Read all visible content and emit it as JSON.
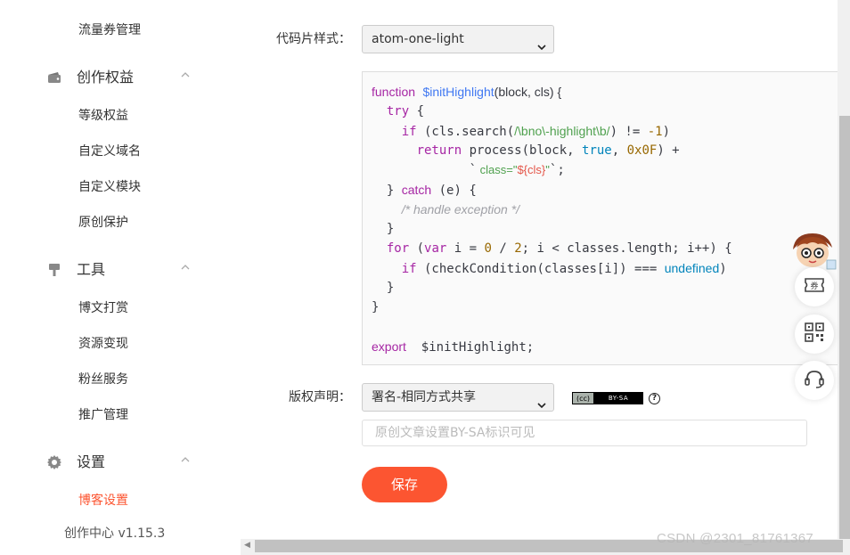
{
  "sidebar": {
    "top_item": "流量券管理",
    "groups": [
      {
        "label": "创作权益",
        "icon": "wallet-icon",
        "items": [
          "等级权益",
          "自定义域名",
          "自定义模块",
          "原创保护"
        ]
      },
      {
        "label": "工具",
        "icon": "hammer-icon",
        "items": [
          "博文打赏",
          "资源变现",
          "粉丝服务",
          "推广管理"
        ]
      },
      {
        "label": "设置",
        "icon": "gear-icon",
        "items": [
          "博客设置"
        ]
      }
    ],
    "active_item": "博客设置",
    "version": "创作中心 v1.15.3"
  },
  "form": {
    "code_style_label": "代码片样式：",
    "code_style_value": "atom-one-light",
    "copyright_label": "版权声明：",
    "copyright_value": "署名-相同方式共享",
    "cc_badge_left": "(cc)",
    "cc_badge_right": "BY-SA",
    "help_icon": "?",
    "hint_placeholder": "原创文章设置BY-SA标识可见",
    "save_label": "保存"
  },
  "code_sample": {
    "l1_kw": "function",
    "l1_fn": "$initHighlight",
    "l1_rest": "(block, cls) {",
    "l2_kw": "try",
    "l2_rest": " {",
    "l3_kw": "if",
    "l3_a": " (cls.search(",
    "l3_re": "/\\bno\\-highlight\\b/",
    "l3_b": ") != ",
    "l3_num": "-1",
    "l3_c": ")",
    "l4_kw": "return",
    "l4_a": " process(block, ",
    "l4_lit": "true",
    "l4_b": ", ",
    "l4_num": "0x0F",
    "l4_c": ") +",
    "l5_a": "`",
    "l5_str1": " class=\"",
    "l5_prop": "${cls}",
    "l5_str2": "\"",
    "l5_b": "`;",
    "l6_a": "} ",
    "l6_kw": "catch",
    "l6_b": " (e) {",
    "l7_cmt": "/* handle exception */",
    "l8": "}",
    "l9_kw": "for",
    "l9_a": " (",
    "l9_kw2": "var",
    "l9_b": " i = ",
    "l9_num": "0",
    "l9_c": " / ",
    "l9_num2": "2",
    "l9_d": "; i < classes.length; i++) {",
    "l10_kw": "if",
    "l10_a": " (checkCondition(classes[i]) === ",
    "l10_lit": "undefined",
    "l10_b": ")",
    "l11": "}",
    "l12": "}",
    "l14_kw": "export",
    "l14_rest": "  $initHighlight;"
  },
  "watermark": "CSDN @2301_81761367",
  "colors": {
    "accent": "#fc5531",
    "keyword": "#a626a4",
    "function": "#4078f2",
    "string": "#50a14f",
    "number": "#986801"
  }
}
